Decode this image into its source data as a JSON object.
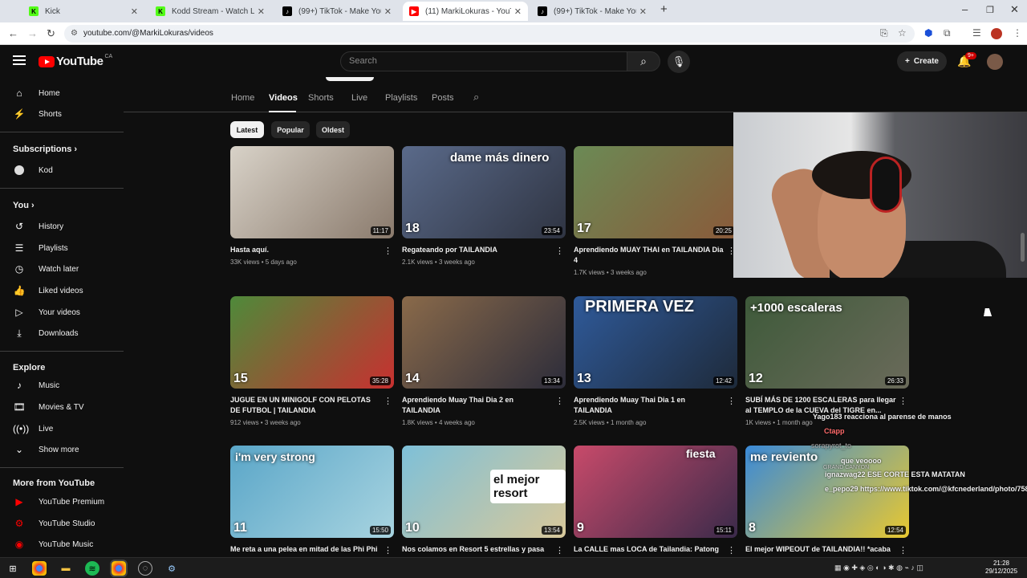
{
  "browser": {
    "tabs": [
      {
        "title": "Kick",
        "favicon": "kick-icon",
        "active": false
      },
      {
        "title": "Kodd Stream - Watch Live on Ki",
        "favicon": "kick-icon",
        "active": false
      },
      {
        "title": "(99+) TikTok - Make Your Day",
        "favicon": "tiktok-icon",
        "active": false
      },
      {
        "title": "(11) MarkiLokuras - YouTube",
        "favicon": "youtube-icon",
        "active": true
      },
      {
        "title": "(99+) TikTok - Make Your Day",
        "favicon": "tiktok-icon",
        "active": false
      }
    ],
    "url": "youtube.com/@MarkiLokuras/videos"
  },
  "youtube": {
    "logo_text": "YouTube",
    "country": "CA",
    "search_placeholder": "Search",
    "create_label": "Create",
    "notif_badge": "9+"
  },
  "sidebar": {
    "main": [
      {
        "label": "Home",
        "icon": "home-icon"
      },
      {
        "label": "Shorts",
        "icon": "shorts-icon"
      }
    ],
    "subscriptions_header": "Subscriptions",
    "subscriptions": [
      {
        "label": "Kod"
      }
    ],
    "you_header": "You",
    "you": [
      {
        "label": "History",
        "icon": "history-icon"
      },
      {
        "label": "Playlists",
        "icon": "playlists-icon"
      },
      {
        "label": "Watch later",
        "icon": "clock-icon"
      },
      {
        "label": "Liked videos",
        "icon": "thumbs-up-icon"
      },
      {
        "label": "Your videos",
        "icon": "your-videos-icon"
      },
      {
        "label": "Downloads",
        "icon": "download-icon"
      }
    ],
    "explore_header": "Explore",
    "explore": [
      {
        "label": "Music",
        "icon": "music-icon"
      },
      {
        "label": "Movies & TV",
        "icon": "movies-icon"
      },
      {
        "label": "Live",
        "icon": "live-icon"
      },
      {
        "label": "Show more",
        "icon": "chevron-down-icon"
      }
    ],
    "more_header": "More from YouTube",
    "more": [
      {
        "label": "YouTube Premium"
      },
      {
        "label": "YouTube Studio"
      },
      {
        "label": "YouTube Music"
      }
    ]
  },
  "channel_tabs": [
    "Home",
    "Videos",
    "Shorts",
    "Live",
    "Playlists",
    "Posts"
  ],
  "active_channel_tab": "Videos",
  "filters": [
    "Latest",
    "Popular",
    "Oldest"
  ],
  "active_filter": "Latest",
  "videos": [
    {
      "title": "Hasta aquí.",
      "views": "33K views",
      "age": "5 days ago",
      "duration": "11:17",
      "episode": "",
      "caption": "",
      "colors": [
        "#d8d2c8",
        "#8a7a6c"
      ]
    },
    {
      "title": "Regateando por TAILANDIA",
      "views": "2.1K views",
      "age": "3 weeks ago",
      "duration": "23:54",
      "episode": "18",
      "caption": "dame más dinero",
      "colors": [
        "#5a6a8a",
        "#2f3442"
      ]
    },
    {
      "title": "Aprendiendo MUAY THAI en TAILANDIA Dia 4",
      "views": "1.7K views",
      "age": "3 weeks ago",
      "duration": "20:25",
      "episode": "17",
      "caption": "",
      "colors": [
        "#6b8a55",
        "#8a5a3a"
      ]
    },
    {
      "title": "JUGUE EN UN MINIGOLF CON PELOTAS DE FUTBOL | TAILANDIA",
      "views": "912 views",
      "age": "3 weeks ago",
      "duration": "35:28",
      "episode": "15",
      "caption": "",
      "colors": [
        "#4e8a3a",
        "#c83030"
      ]
    },
    {
      "title": "Aprendiendo Muay Thai Dia 2 en TAILANDIA",
      "views": "1.8K views",
      "age": "4 weeks ago",
      "duration": "13:34",
      "episode": "14",
      "caption": "",
      "colors": [
        "#8a6a4a",
        "#2c2c3a"
      ]
    },
    {
      "title": "Aprendiendo Muay Thai Dia 1 en TAILANDIA",
      "views": "2.5K views",
      "age": "1 month ago",
      "duration": "12:42",
      "episode": "13",
      "caption": "PRIMERA VEZ",
      "colors": [
        "#2f5a9a",
        "#1e2a3a"
      ]
    },
    {
      "title": "SUBÍ MÁS DE 1200 ESCALERAS para llegar al TEMPLO de la CUEVA del TIGRE en...",
      "views": "1K views",
      "age": "1 month ago",
      "duration": "26:33",
      "episode": "12",
      "caption": "+1000 escaleras",
      "colors": [
        "#3e5a3a",
        "#6a6a5a"
      ]
    },
    {
      "title": "Me reta a una pelea en mitad de las Phi Phi",
      "views": "",
      "age": "",
      "duration": "15:50",
      "episode": "11",
      "caption": "i'm very strong",
      "colors": [
        "#5aa6c8",
        "#a8d4e0"
      ]
    },
    {
      "title": "Nos colamos en Resort 5 estrellas y pasa",
      "views": "",
      "age": "",
      "duration": "13:54",
      "episode": "10",
      "caption": "el mejor resort",
      "colors": [
        "#7ec0d8",
        "#d8c89a"
      ]
    },
    {
      "title": "La CALLE mas LOCA de Tailandia: Patong",
      "views": "",
      "age": "",
      "duration": "15:11",
      "episode": "9",
      "caption": "fiesta",
      "colors": [
        "#c84a6a",
        "#3a2a4a"
      ]
    },
    {
      "title": "El mejor WIPEOUT de TAILANDIA!! *acaba",
      "views": "",
      "age": "",
      "duration": "12:54",
      "episode": "8",
      "caption": "me reviento",
      "colors": [
        "#3a8ad8",
        "#e8c830"
      ]
    }
  ],
  "overlay_chat": [
    {
      "text": "Yago183 reacciona al parense de manos",
      "color": "#ffffff"
    },
    {
      "text": "Ctapp",
      "color": "#ff6a6a"
    },
    {
      "text": "sorapyrot_to",
      "color": "#aaaaaa"
    },
    {
      "text": "que veoooo",
      "color": "#ffffff"
    },
    {
      "text": "GRAND CANYON",
      "color": "#cccccc"
    },
    {
      "text": "ignazwag22 ESE CORTE ESTA MATATAN",
      "color": "#ffffff"
    },
    {
      "text": "e_pepo29 https://www.tiktok.com/@kfcnederland/photo/75882",
      "color": "#ffffff"
    }
  ],
  "taskbar": {
    "apps": [
      "windows-icon",
      "chrome-icon",
      "file-explorer-icon",
      "spotify-icon",
      "chrome-icon",
      "obs-icon",
      "steam-icon"
    ],
    "time": "21:28",
    "date": "29/12/2025"
  }
}
